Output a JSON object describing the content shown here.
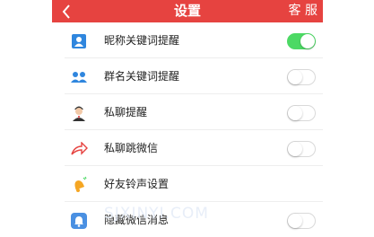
{
  "header": {
    "title": "设置",
    "service_label": "客 服"
  },
  "settings": [
    {
      "label": "昵称关键词提醒",
      "icon": "contact-card-icon",
      "toggle": true,
      "toggle_on": true,
      "icon_color": "#2f86de"
    },
    {
      "label": "群名关键词提醒",
      "icon": "group-icon",
      "toggle": true,
      "toggle_on": false,
      "icon_color": "#2f86de"
    },
    {
      "label": "私聊提醒",
      "icon": "person-avatar-icon",
      "toggle": true,
      "toggle_on": false,
      "icon_color": "#d86a3a"
    },
    {
      "label": "私聊跳微信",
      "icon": "jump-arrow-icon",
      "toggle": true,
      "toggle_on": false,
      "icon_color": "#e64340"
    },
    {
      "label": "好友铃声设置",
      "icon": "bell-icon",
      "toggle": false,
      "icon_color": "#f5a623"
    },
    {
      "label": "隐藏微信消息",
      "icon": "hidden-message-icon",
      "toggle": true,
      "toggle_on": false,
      "icon_color": "#4a90e2"
    }
  ],
  "watermark": "SJXINYI.COM",
  "colors": {
    "header": "#e64340",
    "toggle_on": "#4cd964"
  }
}
